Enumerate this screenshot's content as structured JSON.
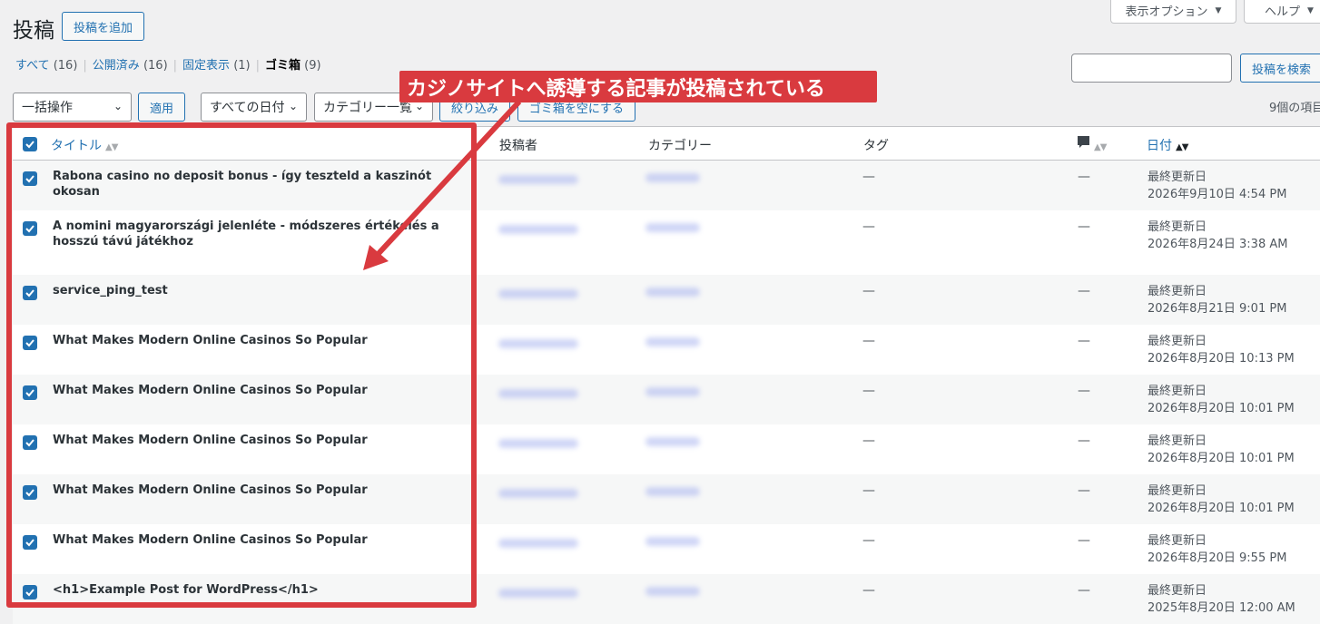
{
  "header": {
    "title": "投稿",
    "add_new": "投稿を追加",
    "screen_options": "表示オプション",
    "help": "ヘルプ"
  },
  "filters": {
    "all_label": "すべて",
    "all_count": "(16)",
    "published_label": "公開済み",
    "published_count": "(16)",
    "sticky_label": "固定表示",
    "sticky_count": "(1)",
    "trash_label": "ゴミ箱",
    "trash_count": "(9)",
    "separator": "|"
  },
  "search": {
    "value": "",
    "button": "投稿を検索"
  },
  "toolbar": {
    "bulk_action": "一括操作",
    "apply": "適用",
    "date_filter": "すべての日付",
    "category_filter": "カテゴリー一覧",
    "filter_button": "絞り込み",
    "empty_trash": "ゴミ箱を空にする",
    "items_count": "9個の項目"
  },
  "columns": {
    "title": "タイトル",
    "author": "投稿者",
    "categories": "カテゴリー",
    "tags": "タグ",
    "date": "日付"
  },
  "rows": [
    {
      "title": "Rabona casino no deposit bonus - így teszteld a kaszinót okosan",
      "tags": "—",
      "comments": "—",
      "date_label": "最終更新日",
      "date": "2026年9月10日 4:54 PM"
    },
    {
      "title": "A nomini magyarországi jelenléte - módszeres értékelés a hosszú távú játékhoz",
      "tags": "—",
      "comments": "—",
      "date_label": "最終更新日",
      "date": "2026年8月24日 3:38 AM"
    },
    {
      "title": "service_ping_test",
      "tags": "—",
      "comments": "—",
      "date_label": "最終更新日",
      "date": "2026年8月21日 9:01 PM"
    },
    {
      "title": "What Makes Modern Online Casinos So Popular",
      "tags": "—",
      "comments": "—",
      "date_label": "最終更新日",
      "date": "2026年8月20日 10:13 PM"
    },
    {
      "title": "What Makes Modern Online Casinos So Popular",
      "tags": "—",
      "comments": "—",
      "date_label": "最終更新日",
      "date": "2026年8月20日 10:01 PM"
    },
    {
      "title": "What Makes Modern Online Casinos So Popular",
      "tags": "—",
      "comments": "—",
      "date_label": "最終更新日",
      "date": "2026年8月20日 10:01 PM"
    },
    {
      "title": "What Makes Modern Online Casinos So Popular",
      "tags": "—",
      "comments": "—",
      "date_label": "最終更新日",
      "date": "2026年8月20日 10:01 PM"
    },
    {
      "title": "What Makes Modern Online Casinos So Popular",
      "tags": "—",
      "comments": "—",
      "date_label": "最終更新日",
      "date": "2026年8月20日 9:55 PM"
    },
    {
      "title": "<h1>Example Post for WordPress</h1>",
      "tags": "—",
      "comments": "—",
      "date_label": "最終更新日",
      "date": "2025年8月20日 12:00 AM"
    }
  ],
  "annotation": {
    "text": "カジノサイトへ誘導する記事が投稿されている"
  },
  "colors": {
    "accent": "#2271b1",
    "annotation_red": "#d93a3f"
  }
}
